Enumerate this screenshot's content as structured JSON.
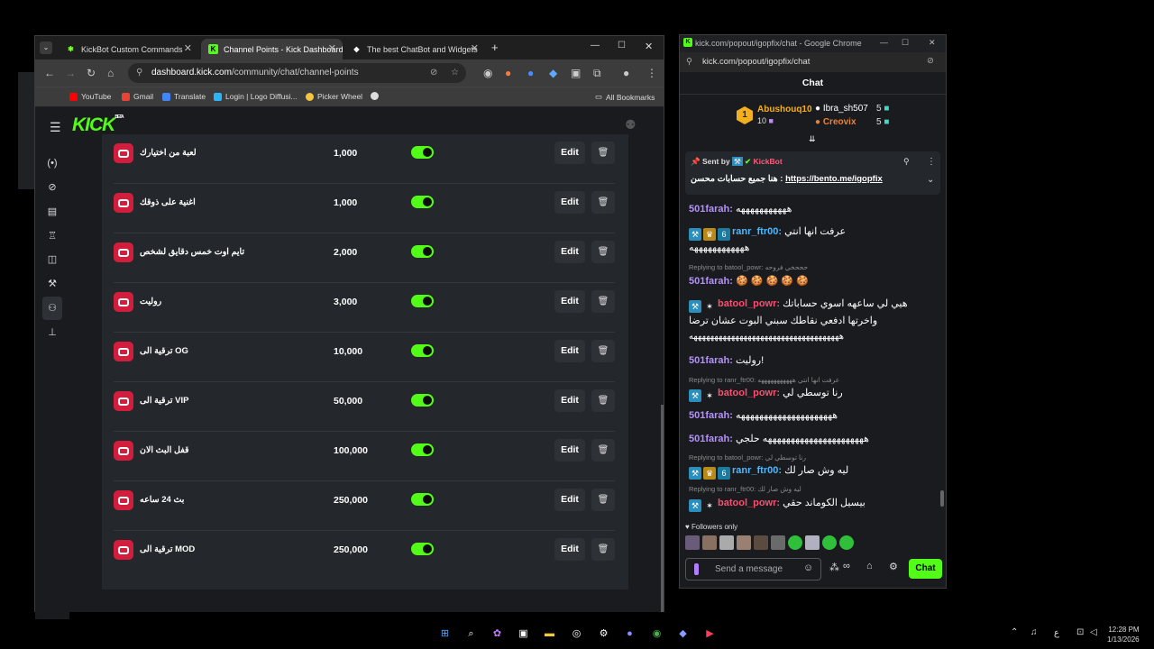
{
  "browser_left": {
    "tabs": [
      {
        "label": "KickBot Custom Commands",
        "active": false
      },
      {
        "label": "Channel Points - Kick Dashboard",
        "active": true
      },
      {
        "label": "The best ChatBot and Widgets",
        "active": false
      }
    ],
    "url_domain": "dashboard.kick.com",
    "url_path": "/community/chat/channel-points",
    "bookmarks": [
      "YouTube",
      "Gmail",
      "Translate",
      "Login | Logo Diffusi...",
      "Picker Wheel"
    ],
    "all_bookmarks": "All Bookmarks"
  },
  "kick": {
    "logo": "KICK",
    "logo_sup": "BETA",
    "rewards": [
      {
        "name": "لعبة من اختيارك",
        "cost": "1,000",
        "enabled": true
      },
      {
        "name": "اغنية على ذوقك",
        "cost": "1,000",
        "enabled": true
      },
      {
        "name": "تايم اوت خمس دقايق لشخص",
        "cost": "2,000",
        "enabled": true
      },
      {
        "name": "روليت",
        "cost": "3,000",
        "enabled": true
      },
      {
        "name": "ترقية الى OG",
        "cost": "10,000",
        "enabled": true
      },
      {
        "name": "ترقية الى VIP",
        "cost": "50,000",
        "enabled": true
      },
      {
        "name": "قفل البث الان",
        "cost": "100,000",
        "enabled": true
      },
      {
        "name": "بث 24 ساعه",
        "cost": "250,000",
        "enabled": true
      },
      {
        "name": "ترقية الى MOD",
        "cost": "250,000",
        "enabled": true
      }
    ],
    "edit_label": "Edit"
  },
  "browser_right": {
    "title": "kick.com/popout/igopfix/chat - Google Chrome",
    "url": "kick.com/popout/igopfix/chat",
    "chat_header": "Chat",
    "leaders": {
      "first": {
        "name": "Abushouq10",
        "points": "10",
        "rank": "1"
      },
      "second": {
        "name": "Ibra_sh507",
        "points": "5"
      },
      "third": {
        "name": "Creovix",
        "points": "5"
      }
    },
    "pinned": {
      "sent_by": "Sent by",
      "bot_name": "KickBot",
      "text": "هنا جميع حسابات محسن :",
      "link": "https://bento.me/igopfix"
    },
    "messages": [
      {
        "user": "501farah:",
        "text": "هههههههههههه",
        "color": "#b590ff"
      },
      {
        "user": "ranr_ftr00:",
        "text": "عرفت انها انتي",
        "text2": "ههههههههههههه",
        "color": "#4db8ff"
      },
      {
        "reply": "Replying to batool_powr: حححخي فروحه"
      },
      {
        "user": "501farah:",
        "text": "🍪 🍪 🍪 🍪 🍪",
        "color": "#b590ff"
      },
      {
        "user": "batool_powr:",
        "text": "هيي لي ساعهه اسوي حساباتك",
        "text2": "واخرتها ادفعي نقاطك سبني البوت عشان ترضا",
        "text3": "ههههههههههههههههههههههههههههههههههههه",
        "color": "#ff4d6d"
      },
      {
        "user": "501farah:",
        "text": "روليت!",
        "color": "#b590ff"
      },
      {
        "reply": "Replying to ranr_ftr00: عرفت انها انتي هههههههههههه"
      },
      {
        "user": "batool_powr:",
        "text": "رنا توسطي لي",
        "color": "#ff4d6d"
      },
      {
        "user": "501farah:",
        "text": "هههههههههههههههههههههه",
        "color": "#b590ff"
      },
      {
        "user": "501farah:",
        "text": "ههههههههههههههههههههههه حلجي",
        "color": "#b590ff"
      },
      {
        "reply": "Replying to batool_powr: رنا توسطي لي"
      },
      {
        "user": "ranr_ftr00:",
        "text": "ليه وش صار لك",
        "color": "#4db8ff"
      },
      {
        "reply": "Replying to ranr_ftr00: ليه وش صار لك"
      },
      {
        "user": "batool_powr:",
        "text": "بيسيل الكوماند حقي",
        "color": "#ff4d6d"
      }
    ],
    "followers_only": "Followers only",
    "input_placeholder": "Send a message",
    "chat_button": "Chat"
  },
  "taskbar": {
    "time": "12:28 PM",
    "date": "1/13/2026",
    "lang": "ع"
  },
  "colors": {
    "kick_green": "#53fc18",
    "reward_red": "#d21e3c"
  }
}
